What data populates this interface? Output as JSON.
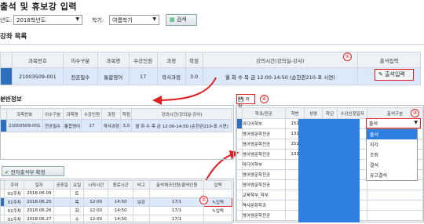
{
  "header": {
    "title": "출석 및 휴보강 입력"
  },
  "filters": {
    "year_label": "년도:",
    "year_value": "2018학년도",
    "term_label": "학기:",
    "term_value": "여름학기",
    "search_label": "검색"
  },
  "course_list": {
    "title": "강좌 목록",
    "columns": [
      "과목번호",
      "이수구분",
      "과목명",
      "수강인원",
      "과정",
      "학점",
      "강의시간(강의실-강사)",
      "출석입력"
    ],
    "row": {
      "code": "21003509-001",
      "type": "전공필수",
      "name": "통합영어",
      "count": "17",
      "course": "학사과정",
      "credit": "3.0",
      "time": "월 화 수 목 금 12:00-14:50 (순헌관210-표 시연)",
      "action": "출석입력"
    }
  },
  "class_info": {
    "title": "분반정보",
    "columns": [
      "과목번호",
      "이수구분",
      "과목명",
      "수강인원",
      "과정",
      "학점",
      "강의시간(강의실-강사)"
    ],
    "row": {
      "code": "21003509-001",
      "type": "전공필수",
      "name": "통합영어",
      "count": "17",
      "course": "학사과정",
      "credit": "3.0",
      "time": "월 화 수 목 금 12:00-14:50 (순헌관210-표 시연)"
    }
  },
  "confirm_button": "전자출석부 확정",
  "session_table": {
    "columns": [
      "주차",
      "일자",
      "공휴일",
      "요일",
      "시작시간",
      "종료시간",
      "비고",
      "출석체크인원/결석인원",
      "입력"
    ],
    "rows": [
      {
        "week": "01주차",
        "date": "2018.06.09",
        "holiday": "",
        "day": "토",
        "start": "",
        "end": "",
        "note": "",
        "count": "",
        "input": ""
      },
      {
        "week": "01주차",
        "date": "2018.06.25",
        "holiday": "",
        "day": "목",
        "start": "12:00",
        "end": "14:50",
        "note": "보강",
        "count": "17/1",
        "input": "입력"
      },
      {
        "week": "01주차",
        "date": "2018.06.26",
        "holiday": "",
        "day": "화",
        "start": "12:00",
        "end": "14:50",
        "note": "",
        "count": "17/1",
        "input": "입력"
      },
      {
        "week": "01주차",
        "date": "2018.06.27",
        "holiday": "",
        "day": "수",
        "start": "12:00",
        "end": "14:50",
        "note": "",
        "count": "17/1",
        "input": ""
      }
    ]
  },
  "student_panel": {
    "save_label": "저장",
    "columns": [
      "학과/전공",
      "학번",
      "성명",
      "학년",
      "수강신청일자",
      "출석구분"
    ],
    "rows": [
      "미디어학부",
      "영어영문학전공",
      "영어영문학전공",
      "영어영문학전공",
      "미디어학부",
      "영어영문학전공",
      "영어영문학전공",
      "교육학부_학부",
      "역사문화학과",
      "영어영문학전공"
    ],
    "id_prefixes": [
      "151",
      "131",
      "151",
      "131",
      "",
      "",
      "",
      "",
      "",
      ""
    ],
    "status_value": "출석",
    "dropdown_options": [
      "출석",
      "지각",
      "조퇴",
      "결석",
      "유고결석"
    ],
    "colors": {
      "selected": "#2f7fe0",
      "highlight": "#e02020"
    }
  },
  "annotations": [
    "①",
    "②",
    "③",
    "④"
  ]
}
